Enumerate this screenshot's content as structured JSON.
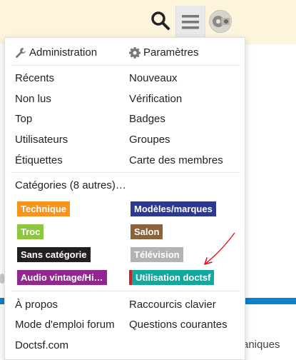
{
  "header": {
    "search_icon": "search-icon",
    "menu_icon": "hamburger-icon",
    "avatar": "user-avatar"
  },
  "menu": {
    "admin_label": "Administration",
    "settings_label": "Paramètres",
    "links_left": [
      "Récents",
      "Non lus",
      "Top",
      "Utilisateurs",
      "Étiquettes"
    ],
    "links_right": [
      "Nouveaux",
      "Vérification",
      "Badges",
      "Groupes",
      "Carte des membres"
    ],
    "categories_title": "Catégories (8 autres)…",
    "categories": [
      {
        "label": "Technique",
        "color": "#f7941d"
      },
      {
        "label": "Modèles/marques",
        "color": "#2b3990"
      },
      {
        "label": "Troc",
        "color": "#8dc63f"
      },
      {
        "label": "Salon",
        "color": "#8c6238"
      },
      {
        "label": "Sans catégorie",
        "color": "#231f20"
      },
      {
        "label": "Télévision",
        "color": "#b3b3b3"
      },
      {
        "label": "Audio vintage/Hi…",
        "color": "#92278f"
      },
      {
        "label": "Utilisation doctsf",
        "color": "#12a89d",
        "parent_color": "#c0272d"
      }
    ],
    "footer_left": [
      "À propos",
      "Mode d'emploi forum",
      "Doctsf.com"
    ],
    "footer_right": [
      "Raccourcis clavier",
      "Questions courantes"
    ]
  },
  "background": {
    "partial_text": "aniques"
  },
  "colors": {
    "topbar": "#fdf4dc",
    "blue_strip": "#0a82c8",
    "annotation_arrow": "#e8141a"
  }
}
